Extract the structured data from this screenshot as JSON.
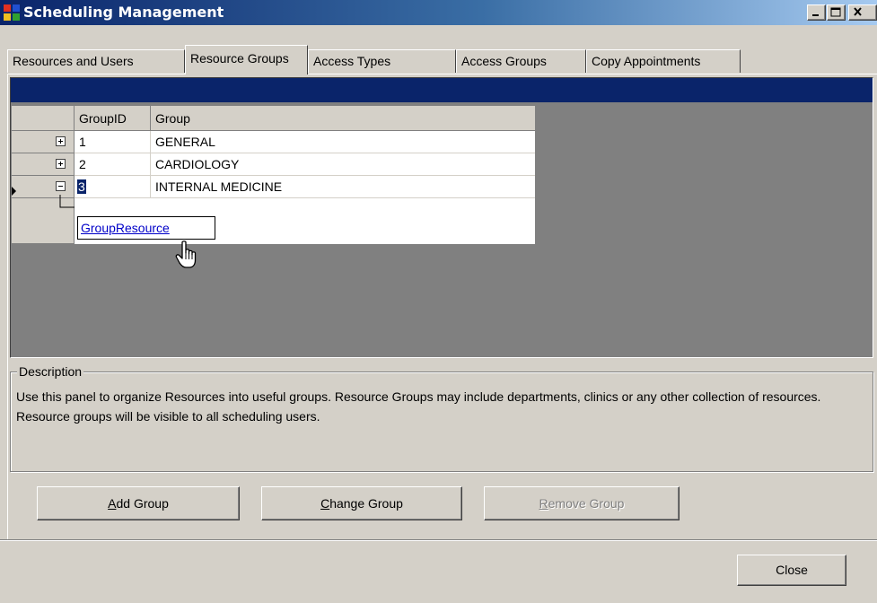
{
  "window": {
    "title": "Scheduling Management"
  },
  "tabs": [
    {
      "label": "Resources and Users",
      "active": false
    },
    {
      "label": "Resource Groups",
      "active": true
    },
    {
      "label": "Access Types",
      "active": false
    },
    {
      "label": "Access Groups",
      "active": false
    },
    {
      "label": "Copy Appointments",
      "active": false
    }
  ],
  "grid": {
    "columns": [
      "GroupID",
      "Group"
    ],
    "rows": [
      {
        "id": "1",
        "group": "GENERAL",
        "expanded": false
      },
      {
        "id": "2",
        "group": "CARDIOLOGY",
        "expanded": false
      },
      {
        "id": "3",
        "group": "INTERNAL MEDICINE",
        "expanded": true,
        "current": true
      }
    ],
    "child_relation": "GroupResource"
  },
  "description": {
    "legend": "Description",
    "text": "Use this panel to organize Resources into useful groups.  Resource Groups may include departments, clinics or any other collection of resources.  Resource groups will be visible to all scheduling users."
  },
  "buttons": {
    "add": {
      "mnemonic": "A",
      "rest": "dd Group",
      "enabled": true
    },
    "change": {
      "mnemonic": "C",
      "rest": "hange Group",
      "enabled": true
    },
    "remove": {
      "mnemonic": "R",
      "rest": "emove Group",
      "enabled": false
    },
    "close": {
      "label": "Close",
      "enabled": true
    }
  },
  "colors": {
    "face": "#d4d0c8",
    "titlebar": "#0a246a",
    "selection": "#0a246a",
    "link": "#0000c8"
  }
}
